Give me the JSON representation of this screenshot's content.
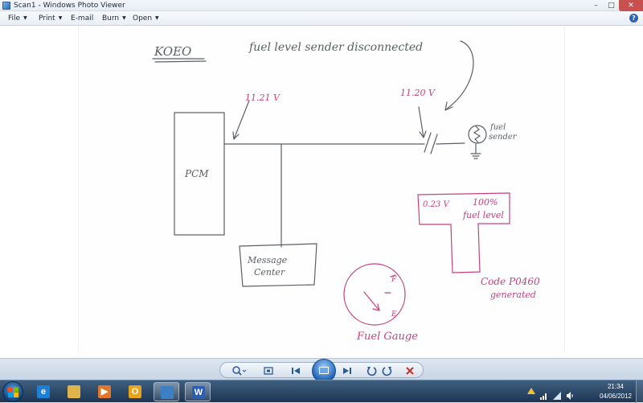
{
  "window": {
    "title": "Scan1 - Windows Photo Viewer",
    "controls": {
      "minimize": "–",
      "maximize": "□",
      "close": "✕"
    }
  },
  "menu": [
    {
      "label": "File",
      "has_arrow": true
    },
    {
      "label": "Print",
      "has_arrow": true
    },
    {
      "label": "E-mail",
      "has_arrow": false
    },
    {
      "label": "Burn",
      "has_arrow": true
    },
    {
      "label": "Open",
      "has_arrow": true
    }
  ],
  "help_label": "?",
  "sketch": {
    "heading": "KOEO",
    "note": "fuel level sender disconnected",
    "voltage_pcm": "11.21 V",
    "voltage_sender": "11.20 V",
    "pcm_label": "PCM",
    "sender_label_line1": "fuel",
    "sender_label_line2": "sender",
    "message_center_line1": "Message",
    "message_center_line2": "Center",
    "scan_voltage": "0.23 V",
    "scan_percent": "100%",
    "scan_level": "fuel level",
    "code_line1": "Code P0460",
    "code_line2": "generated",
    "gauge_f": "F",
    "gauge_e": "E",
    "gauge_label": "Fuel Gauge",
    "colors": {
      "ink": "#5b6066",
      "pink": "#c8407e"
    }
  },
  "bottom_toolbar": {
    "zoom_icon": "magnifier-icon",
    "fit_icon": "actual-size-icon",
    "prev_icon": "previous-icon",
    "slideshow_icon": "slideshow-icon",
    "next_icon": "next-icon",
    "rotate_ccw_icon": "rotate-counterclockwise-icon",
    "rotate_cw_icon": "rotate-clockwise-icon",
    "delete_icon": "delete-icon"
  },
  "taskbar": {
    "apps": [
      {
        "name": "internet-explorer",
        "glyph": "e",
        "color": "#1c7fd6",
        "active": false
      },
      {
        "name": "file-explorer",
        "glyph": "",
        "color": "#e0b44a",
        "active": false
      },
      {
        "name": "media-player",
        "glyph": "▶",
        "color": "#e0772a",
        "active": false
      },
      {
        "name": "outlook",
        "glyph": "O",
        "color": "#e8a21e",
        "active": false
      },
      {
        "name": "photo-viewer",
        "glyph": "",
        "color": "#3b7fc4",
        "active": true
      },
      {
        "name": "word",
        "glyph": "W",
        "color": "#2b5fb3",
        "active": true
      }
    ],
    "time": "21:34",
    "date": "04/06/2012"
  }
}
